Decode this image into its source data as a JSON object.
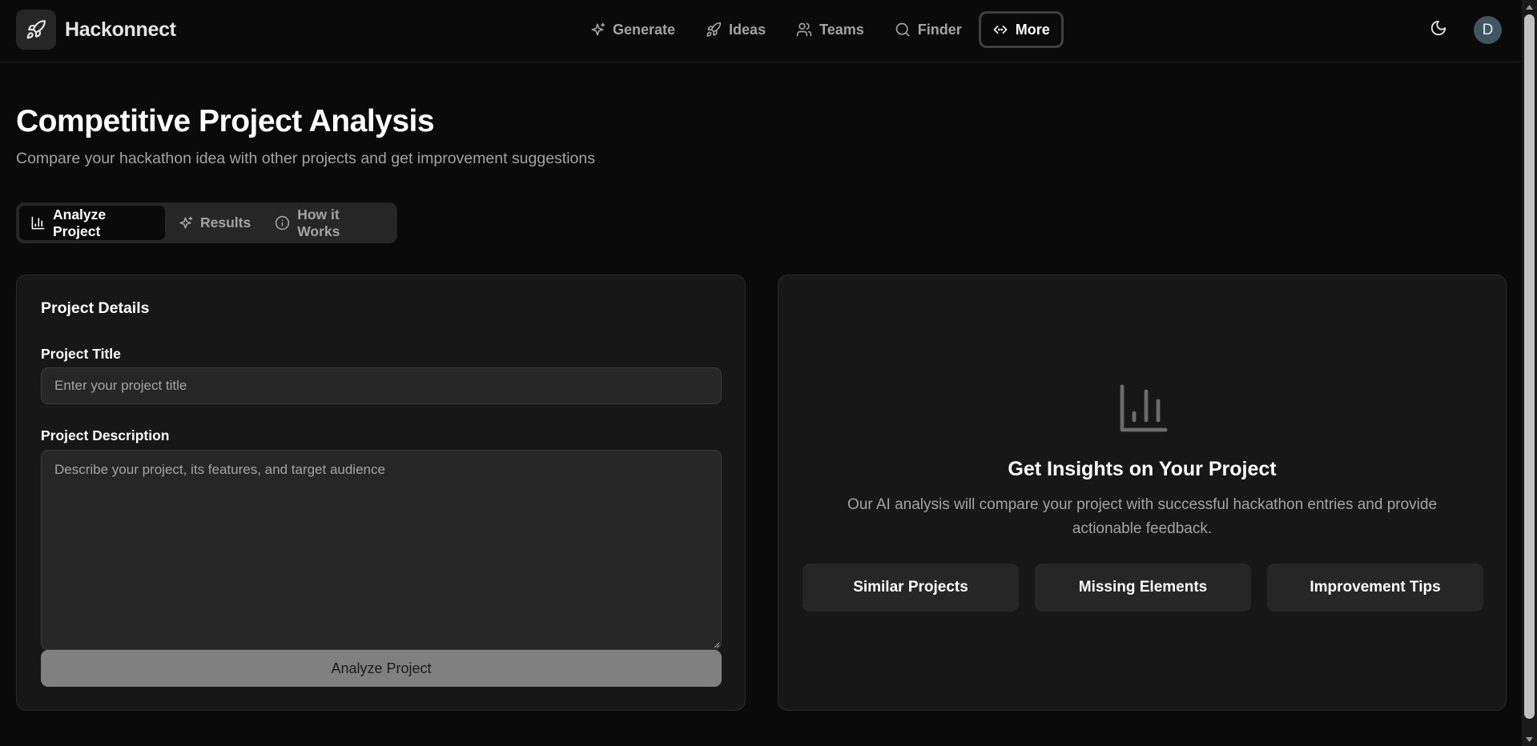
{
  "app": {
    "name": "Hackonnect",
    "logo_icon": "rocket-icon"
  },
  "nav": {
    "items": [
      {
        "label": "Generate",
        "icon": "sparkles-icon"
      },
      {
        "label": "Ideas",
        "icon": "rocket-icon"
      },
      {
        "label": "Teams",
        "icon": "users-icon"
      },
      {
        "label": "Finder",
        "icon": "search-icon"
      },
      {
        "label": "More",
        "icon": "code-icon",
        "active": true
      }
    ]
  },
  "header": {
    "theme_icon": "moon-icon",
    "avatar_initial": "D"
  },
  "page": {
    "title": "Competitive Project Analysis",
    "subtitle": "Compare your hackathon idea with other projects and get improvement suggestions"
  },
  "tabs": [
    {
      "label": "Analyze Project",
      "icon": "bar-chart-icon",
      "active": true
    },
    {
      "label": "Results",
      "icon": "sparkles-icon"
    },
    {
      "label": "How it Works",
      "icon": "info-icon"
    }
  ],
  "form": {
    "card_title": "Project Details",
    "title_label": "Project Title",
    "title_placeholder": "Enter your project title",
    "title_value": "",
    "description_label": "Project Description",
    "description_placeholder": "Describe your project, its features, and target audience",
    "description_value": "",
    "submit_label": "Analyze Project"
  },
  "insights": {
    "icon": "bar-chart-icon",
    "title": "Get Insights on Your Project",
    "text": "Our AI analysis will compare your project with successful hackathon entries and provide actionable feedback.",
    "features": [
      "Similar Projects",
      "Missing Elements",
      "Improvement Tips"
    ]
  },
  "colors": {
    "background": "#0a0a0a",
    "card": "#171717",
    "muted_surface": "#262626",
    "avatar": "#3f5560",
    "button_disabled": "#808080"
  }
}
